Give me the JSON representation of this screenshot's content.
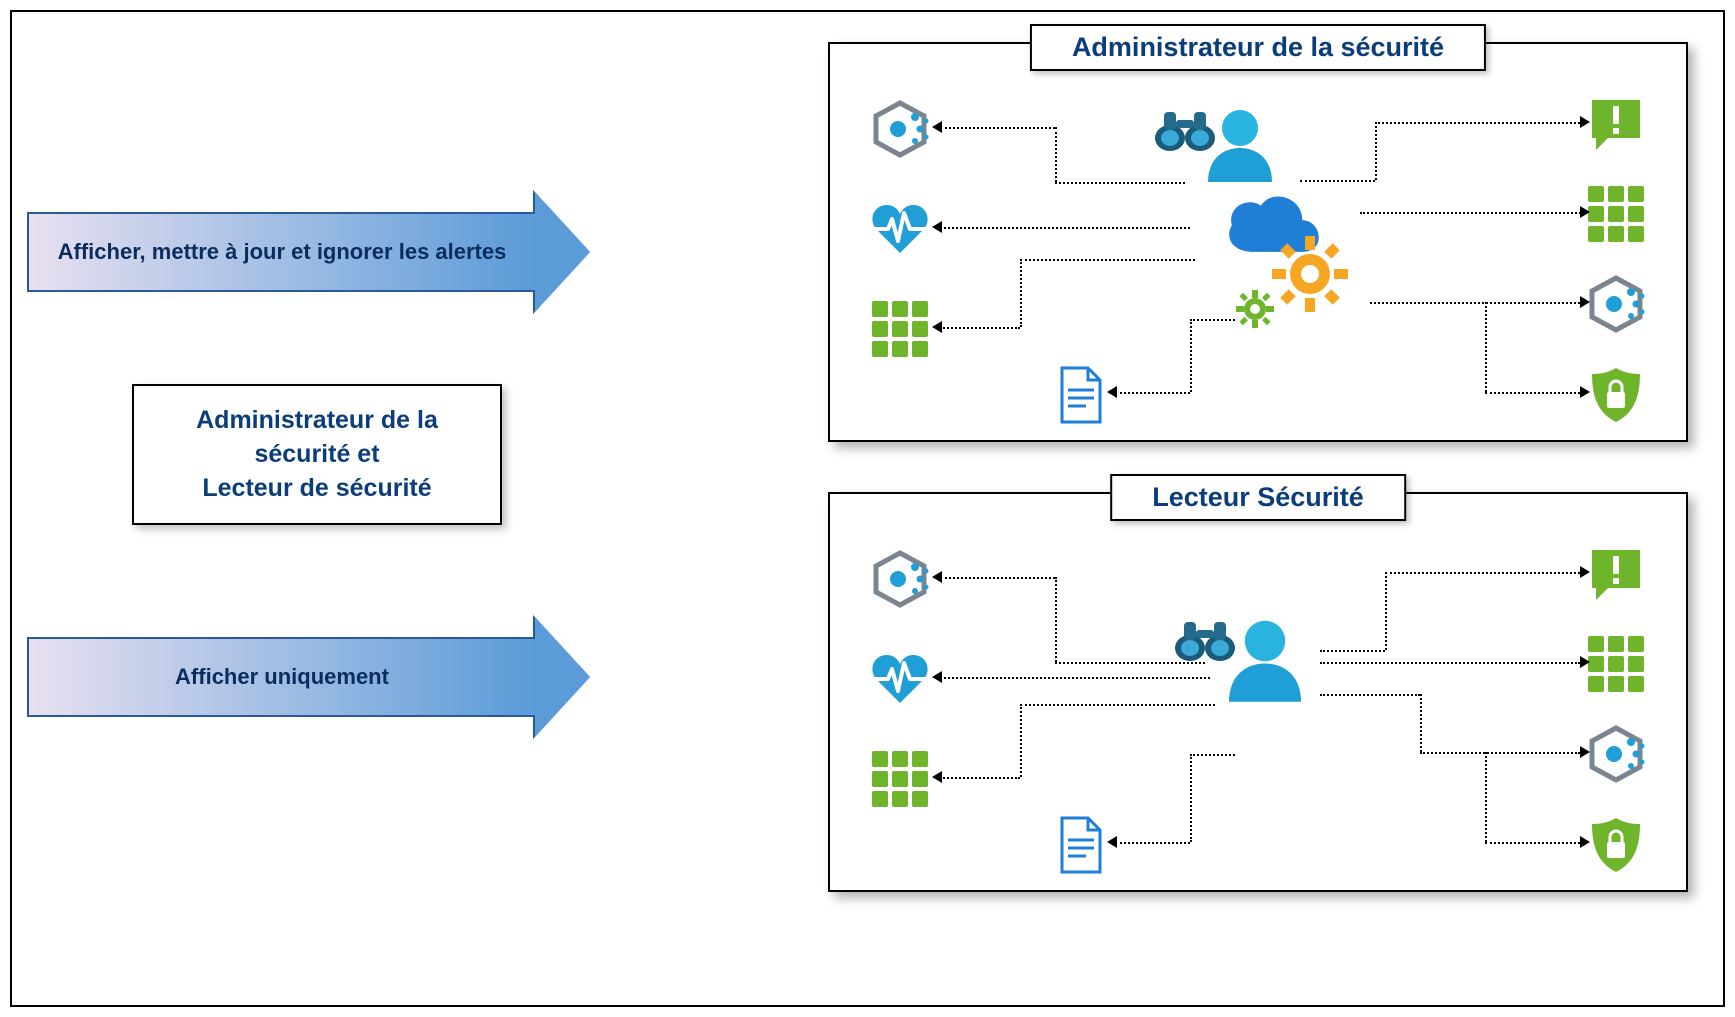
{
  "arrows": {
    "top_label": "Afficher, mettre à jour et ignorer les alertes",
    "bottom_label": "Afficher uniquement"
  },
  "middle_box": {
    "line1": "Administrateur de la",
    "line2": "sécurité et",
    "line3": "Lecteur de sécurité"
  },
  "panels": {
    "admin_title": "Administrateur de la sécurité",
    "reader_title": "Lecteur Sécurité"
  },
  "icons": {
    "hexagon": "hexagon-dots-icon",
    "heart": "heartbeat-icon",
    "grid": "grid-tiles-icon",
    "alert": "alert-speech-icon",
    "shield": "shield-lock-icon",
    "document": "document-icon",
    "person": "person-icon",
    "binoculars": "binoculars-icon",
    "cloud": "cloud-icon",
    "gear": "gear-icon"
  }
}
